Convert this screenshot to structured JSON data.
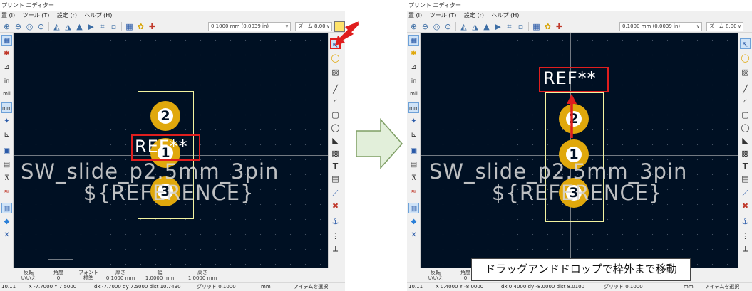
{
  "window": {
    "title": "プリント エディター"
  },
  "menu": [
    "ツール (T)",
    "設定 (r)",
    "ヘルプ (H)"
  ],
  "menu_prefix": "置 (I)",
  "toolbar": {
    "grid_value": "0.1000 mm (0.0039 in)",
    "zoom_value": "ズーム 8.00",
    "icons": [
      "zoom-in-icon",
      "zoom-out-icon",
      "zoom-fit-icon",
      "zoom-selection-icon",
      "rotate-ccw-icon",
      "rotate-cw-icon",
      "mirror-icon",
      "flip-icon",
      "pad-table-icon",
      "grid-icon",
      "footprint-library-icon",
      "footprint-properties-icon",
      "drc-icon"
    ]
  },
  "left_tools": [
    "grid-toggle-icon",
    "netlist-icon",
    "polar-coords-icon",
    "inch-units-icon",
    "mil-units-icon",
    "mm-units-icon",
    "cursor-shape-icon",
    "ratsnest-icon",
    "pad-outline-icon",
    "text-outline-icon",
    "graphic-outline-icon",
    "layers-icon",
    "high-contrast-icon",
    "appearance-icon",
    "properties-icon",
    "tools-icon"
  ],
  "left_tool_glyphs": [
    "▦",
    "✱",
    "⊿",
    "in",
    "mil",
    "mm",
    "✦",
    "⊾",
    "▣",
    "▤",
    "⊼",
    "≈",
    "▥",
    "◆",
    "✕",
    "✕"
  ],
  "right_tools": [
    "select-icon",
    "add-pad-icon",
    "text-box-icon",
    "add-line-icon",
    "add-arc-icon",
    "add-rect-icon",
    "add-circle-icon",
    "add-polygon-icon",
    "add-image-icon",
    "add-text-icon",
    "add-textbox-icon",
    "dimension-icon",
    "delete-icon",
    "anchor-icon",
    "grid-origin-icon",
    "measure-icon"
  ],
  "right_tool_glyphs": [
    "↖",
    "◯",
    "▨",
    "╱",
    "◜",
    "▢",
    "◯",
    "◣",
    "▩",
    "T",
    "▤",
    "⟋",
    "✖",
    "⚓",
    "⋮⋮",
    "⟂"
  ],
  "footprint": {
    "value_text": "SW_slide_p2.5mm_3pin",
    "ref_field_text": "${REFERENCE}",
    "ref_text": "REF**",
    "pads": [
      "1",
      "2",
      "3"
    ]
  },
  "panels": [
    {
      "message_panel": {
        "labels": [
          "反転",
          "角度",
          "フォント",
          "厚さ",
          "幅",
          "高さ"
        ],
        "values": [
          "いいえ",
          "0",
          "標準",
          "0.1000 mm",
          "1.0000 mm",
          "1.0000 mm"
        ]
      },
      "status": {
        "z": "10.11",
        "xy": "X -7.7000  Y 7.5000",
        "delta": "dx -7.7000  dy 7.5000  dist 10.7490",
        "grid": "グリッド 0.1000",
        "units": "mm",
        "action": "アイテムを選択"
      }
    },
    {
      "message_panel": {
        "labels": [
          "反転",
          "角度"
        ],
        "values": [
          "いいえ",
          "0"
        ]
      },
      "status": {
        "z": "10.11",
        "xy": "X 0.4000  Y -8.0000",
        "delta": "dx 0.4000  dy -8.0000  dist 8.0100",
        "grid": "グリッド 0.1000",
        "units": "mm",
        "action": "アイテムを選択"
      }
    }
  ],
  "caption": "ドラッグアンドドロップで枠外まで移動",
  "colors": {
    "canvas_bg": "#001023",
    "pad": "#e0a80c",
    "outline": "#f2f2a0",
    "highlight": "#e01e1e",
    "arrow_fill": "#e2efda",
    "arrow_stroke": "#7f9f65"
  }
}
